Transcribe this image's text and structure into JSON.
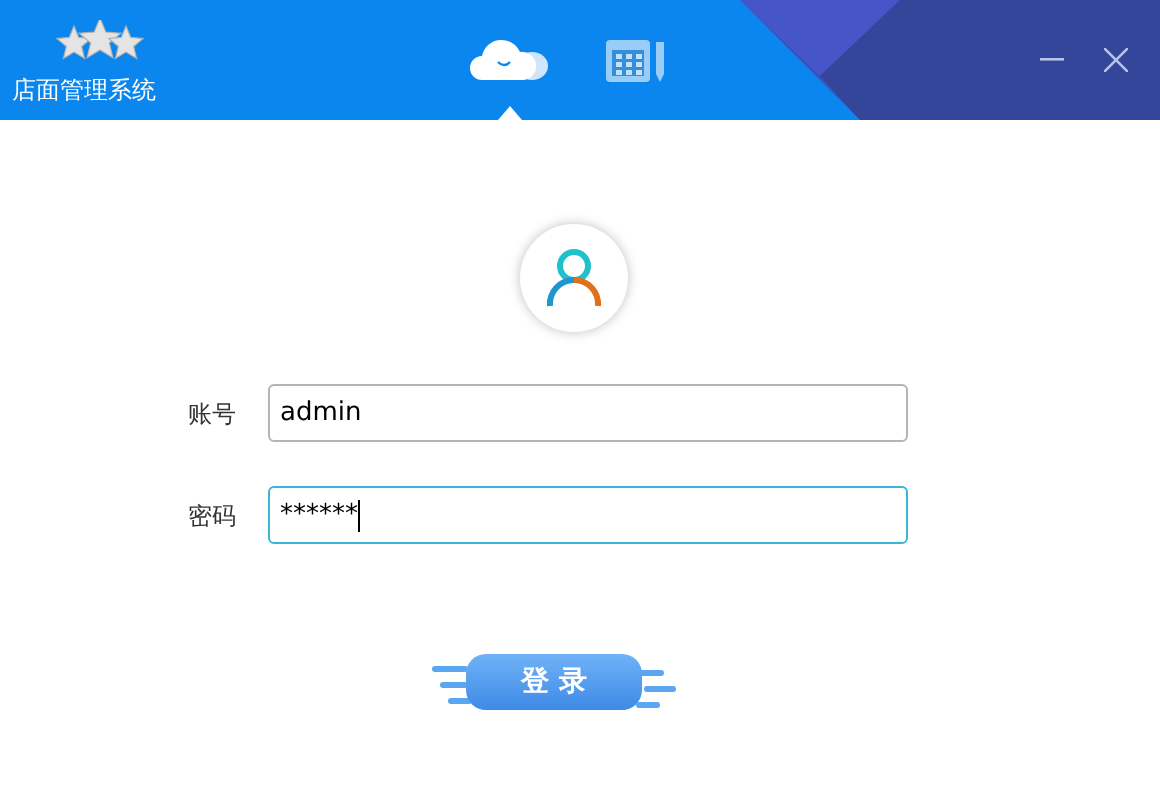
{
  "window": {
    "title": "店面管理系统"
  },
  "tabs": [
    {
      "kind": "cloud",
      "selected": true
    },
    {
      "kind": "calendar",
      "selected": false
    }
  ],
  "fields": [
    {
      "label": "账号",
      "value": "admin",
      "focused": false
    },
    {
      "label": "密码",
      "value": "******",
      "focused": true
    }
  ],
  "login_button": "登 录"
}
